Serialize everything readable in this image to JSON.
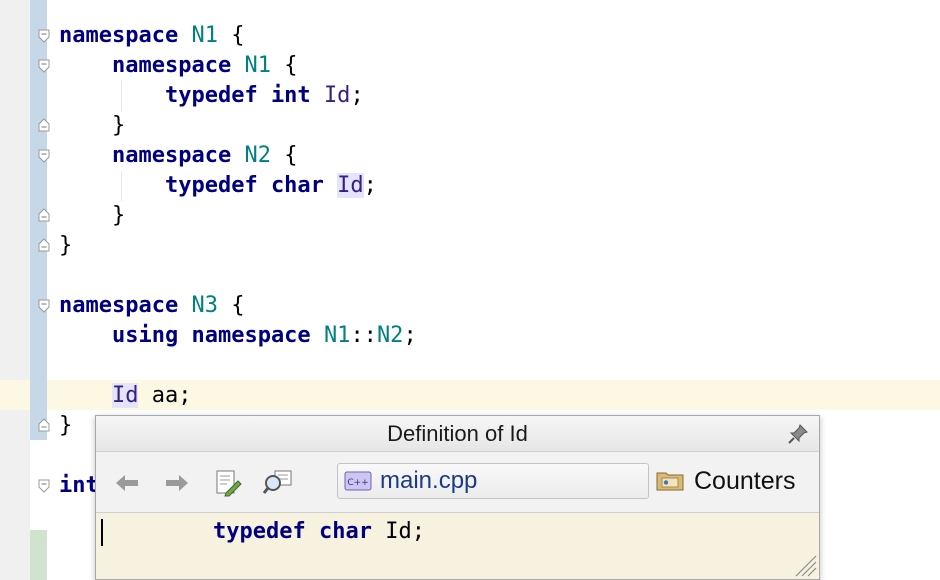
{
  "editor": {
    "lines": [
      {
        "indent": "",
        "tokens": [
          {
            "t": "namespace",
            "c": "kw"
          },
          {
            "t": " "
          },
          {
            "t": "N1",
            "c": "ns"
          },
          {
            "t": " {"
          }
        ]
      },
      {
        "indent": "    ",
        "tokens": [
          {
            "t": "namespace",
            "c": "kw"
          },
          {
            "t": " "
          },
          {
            "t": "N1",
            "c": "ns"
          },
          {
            "t": " {"
          }
        ]
      },
      {
        "indent": "        ",
        "tokens": [
          {
            "t": "typedef",
            "c": "kw"
          },
          {
            "t": " "
          },
          {
            "t": "int",
            "c": "kw"
          },
          {
            "t": " "
          },
          {
            "t": "Id",
            "c": "id"
          },
          {
            "t": ";"
          }
        ]
      },
      {
        "indent": "    ",
        "tokens": [
          {
            "t": "}"
          }
        ]
      },
      {
        "indent": "    ",
        "tokens": [
          {
            "t": "namespace",
            "c": "kw"
          },
          {
            "t": " "
          },
          {
            "t": "N2",
            "c": "ns"
          },
          {
            "t": " {"
          }
        ]
      },
      {
        "indent": "        ",
        "tokens": [
          {
            "t": "typedef",
            "c": "kw"
          },
          {
            "t": " "
          },
          {
            "t": "char",
            "c": "kw"
          },
          {
            "t": " "
          },
          {
            "t": "Id",
            "c": "id id-hl"
          },
          {
            "t": ";"
          }
        ]
      },
      {
        "indent": "    ",
        "tokens": [
          {
            "t": "}"
          }
        ]
      },
      {
        "indent": "",
        "tokens": [
          {
            "t": "}"
          }
        ]
      },
      {
        "indent": "",
        "tokens": []
      },
      {
        "indent": "",
        "tokens": [
          {
            "t": "namespace",
            "c": "kw"
          },
          {
            "t": " "
          },
          {
            "t": "N3",
            "c": "ns"
          },
          {
            "t": " {"
          }
        ]
      },
      {
        "indent": "    ",
        "tokens": [
          {
            "t": "using",
            "c": "kw"
          },
          {
            "t": " "
          },
          {
            "t": "namespace",
            "c": "kw"
          },
          {
            "t": " "
          },
          {
            "t": "N1",
            "c": "ns"
          },
          {
            "t": "::"
          },
          {
            "t": "N2",
            "c": "ns"
          },
          {
            "t": ";"
          }
        ]
      },
      {
        "indent": "",
        "tokens": []
      },
      {
        "indent": "    ",
        "tokens": [
          {
            "t": "Id",
            "c": "id id-hl"
          },
          {
            "t": " aa;"
          }
        ]
      },
      {
        "indent": "",
        "tokens": [
          {
            "t": "}"
          }
        ]
      },
      {
        "indent": "",
        "tokens": []
      },
      {
        "indent": "",
        "tokens": [
          {
            "t": "int",
            "c": "kw"
          }
        ]
      }
    ]
  },
  "popup": {
    "title": "Definition of Id",
    "file_name": "main.cpp",
    "file_icon_label": "C++",
    "scope_label": "Counters",
    "code_kw1": "typedef",
    "code_kw2": "char",
    "code_rest": " Id;",
    "icons": [
      "back-arrow-icon",
      "forward-arrow-icon",
      "edit-source-icon",
      "find-usages-icon",
      "pin-icon",
      "folder-icon",
      "resize-grip-icon"
    ]
  },
  "colors": {
    "keyword": "#000080",
    "namespace": "#008080",
    "identifier": "#371f80",
    "highlight": "#e4e4ff",
    "popup_body": "#f7f2df",
    "current_line": "#fdf8e4"
  }
}
